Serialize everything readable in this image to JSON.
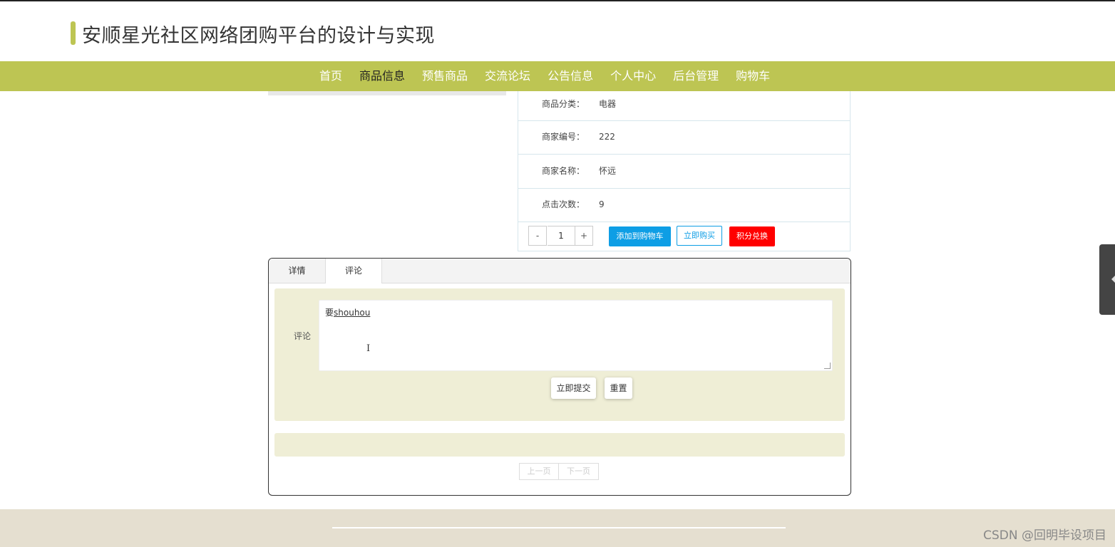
{
  "header": {
    "site_title": "安顺星光社区网络团购平台的设计与实现"
  },
  "nav": {
    "items": [
      {
        "label": "首页"
      },
      {
        "label": "商品信息"
      },
      {
        "label": "预售商品"
      },
      {
        "label": "交流论坛"
      },
      {
        "label": "公告信息"
      },
      {
        "label": "个人中心"
      },
      {
        "label": "后台管理"
      },
      {
        "label": "购物车"
      }
    ],
    "active": "商品信息"
  },
  "product_info": {
    "rows": [
      {
        "label": "商品分类：",
        "value": "电器"
      },
      {
        "label": "商家编号：",
        "value": "222"
      },
      {
        "label": "商家名称：",
        "value": "怀远"
      },
      {
        "label": "点击次数：",
        "value": "9"
      }
    ],
    "quantity": "1",
    "minus_label": "-",
    "plus_label": "+",
    "add_to_cart_label": "添加到购物车",
    "buy_now_label": "立即购买",
    "points_exchange_label": "积分兑换"
  },
  "tabs": {
    "items": [
      {
        "label": "详情"
      },
      {
        "label": "评论"
      }
    ],
    "active": "评论"
  },
  "comment_form": {
    "label": "评论",
    "typed_prefix": "要",
    "typed_composition": "shouhou",
    "submit_label": "立即提交",
    "reset_label": "重置"
  },
  "pagination": {
    "prev_label": "上一页",
    "next_label": "下一页"
  },
  "footer": {
    "watermark": "CSDN @回明毕设项目"
  },
  "colors": {
    "accent": "#bdc553",
    "button_blue": "#0e9ee5",
    "button_red": "#ff0000",
    "form_background": "#efeed6",
    "footer_background": "#e5dfd0"
  }
}
